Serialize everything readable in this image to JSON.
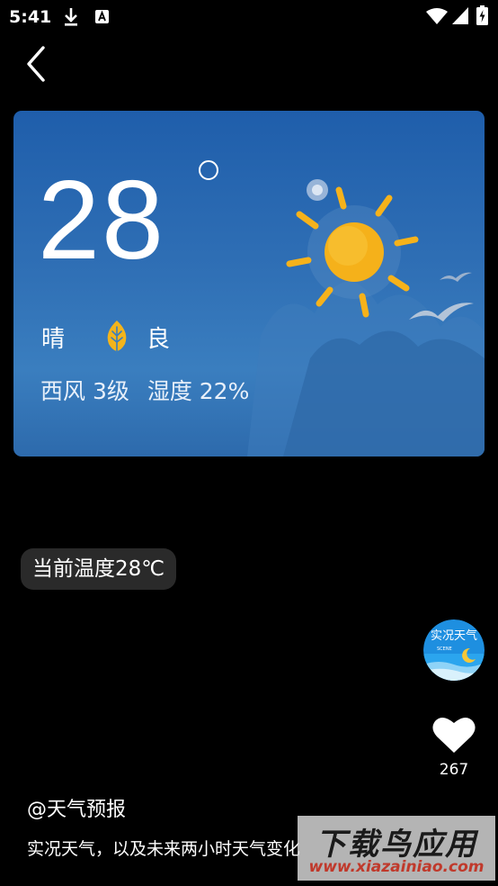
{
  "status_bar": {
    "time": "5:41",
    "icons": [
      "download-icon",
      "a-notification-icon",
      "wifi-icon",
      "signal-icon",
      "battery-charging-icon"
    ]
  },
  "nav": {
    "back_icon": "chevron-left-icon"
  },
  "weather_card": {
    "temperature": "28",
    "condition": "晴",
    "air_quality": "良",
    "wind": "西风 3级",
    "humidity": "湿度 22%"
  },
  "caption_pill": {
    "text": "当前温度28℃"
  },
  "avatar": {
    "title": "实况天气",
    "subtitle": "SCENE"
  },
  "likes": {
    "count": "267"
  },
  "post": {
    "author": "@天气预报",
    "description": "实况天气，以及未来两小时天气变化"
  },
  "watermark": {
    "text": "下载鸟应用",
    "url": "www.xiazainiao.com"
  },
  "colors": {
    "card_top": "#1f5eab",
    "card_bottom": "#3a7ebf",
    "sun": "#f6b21b",
    "leaf": "#f3b41c"
  }
}
